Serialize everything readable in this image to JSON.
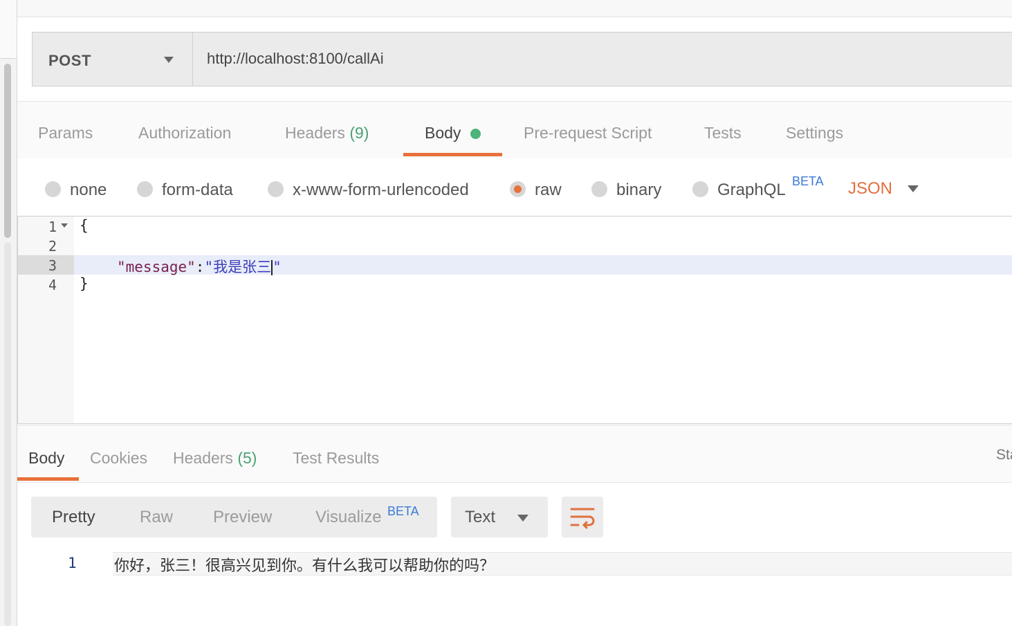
{
  "request": {
    "method": "POST",
    "url": "http://localhost:8100/callAi"
  },
  "request_tabs": {
    "params": "Params",
    "authorization": "Authorization",
    "headers": "Headers",
    "headers_count": "(9)",
    "body": "Body",
    "pre_request": "Pre-request Script",
    "tests": "Tests",
    "settings": "Settings"
  },
  "body_types": {
    "none": "none",
    "form_data": "form-data",
    "urlencoded": "x-www-form-urlencoded",
    "raw": "raw",
    "binary": "binary",
    "graphql": "GraphQL",
    "graphql_badge": "BETA",
    "selected": "raw",
    "format": "JSON"
  },
  "editor": {
    "line_numbers": [
      "1",
      "2",
      "3",
      "4"
    ],
    "line1": "{",
    "key": "\"message\"",
    "colon": ":",
    "value_open": "\"我是张三",
    "value_close": "\"",
    "line4": "}"
  },
  "response_tabs": {
    "body": "Body",
    "cookies": "Cookies",
    "headers": "Headers",
    "headers_count": "(5)",
    "test_results": "Test Results",
    "status_cut": "Sta"
  },
  "response_view": {
    "pretty": "Pretty",
    "raw": "Raw",
    "preview": "Preview",
    "visualize": "Visualize",
    "visualize_badge": "BETA",
    "format": "Text",
    "wrap_icon": "wrap-lines-icon"
  },
  "response_body": {
    "line_number": "1",
    "text": "你好，张三！很高兴见到你。有什么我可以帮助你的吗？"
  },
  "colors": {
    "accent": "#e8703a",
    "count_green": "#4aa373",
    "beta_blue": "#3a7ad6"
  }
}
